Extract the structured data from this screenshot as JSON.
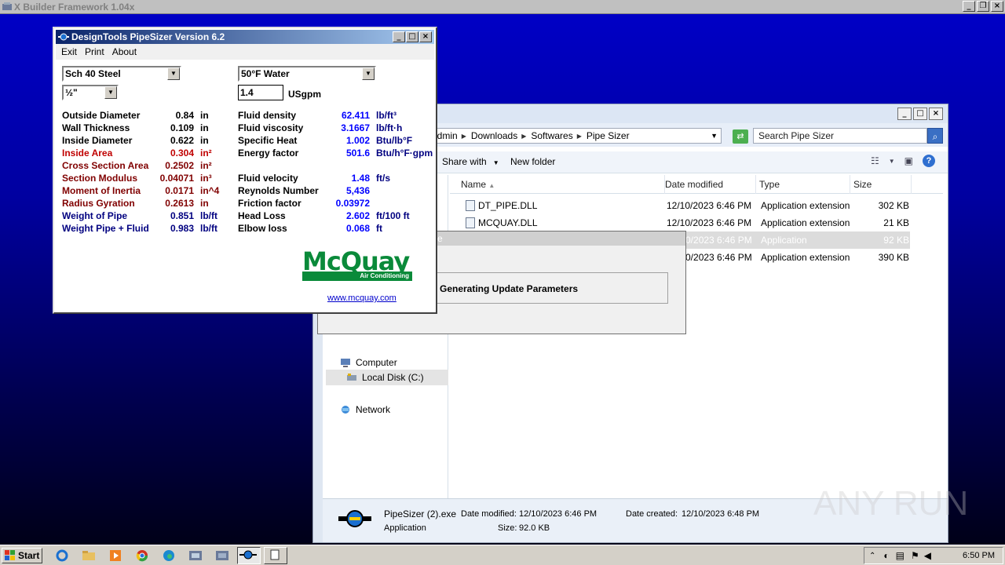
{
  "xbuilder": {
    "title": "X Builder Framework 1.04x"
  },
  "explorer": {
    "breadcrumb": [
      "admin",
      "Downloads",
      "Softwares",
      "Pipe Sizer"
    ],
    "search_placeholder": "Search Pipe Sizer",
    "toolbar": {
      "share_with": "Share with",
      "new_folder": "New folder"
    },
    "nav": {
      "computer": "Computer",
      "local_disk": "Local Disk (C:)",
      "network": "Network"
    },
    "columns": {
      "name": "Name",
      "date_modified": "Date modified",
      "type": "Type",
      "size": "Size"
    },
    "files": [
      {
        "name": "DT_PIPE.DLL",
        "date": "12/10/2023 6:46 PM",
        "type": "Application extension",
        "size": "302 KB"
      },
      {
        "name": "MCQUAY.DLL",
        "date": "12/10/2023 6:46 PM",
        "type": "Application extension",
        "size": "21 KB"
      },
      {
        "name": "",
        "date": "/10/2023 6:46 PM",
        "type": "Application",
        "size": "92 KB"
      },
      {
        "name": "",
        "date": "/10/2023 6:46 PM",
        "type": "Application extension",
        "size": "390 KB"
      }
    ],
    "details": {
      "filename": "PipeSizer (2).exe",
      "date_modified_label": "Date modified:",
      "date_modified": "12/10/2023 6:46 PM",
      "date_created_label": "Date created:",
      "date_created": "12/10/2023 6:48 PM",
      "type": "Application",
      "size_label": "Size:",
      "size": "92.0 KB"
    }
  },
  "progress": {
    "title_fragment": "e",
    "message": "Generating Update Parameters"
  },
  "pipesizer": {
    "title": "DesignTools PipeSizer Version 6.2",
    "menu": [
      "Exit",
      "Print",
      "About"
    ],
    "pipe_type": "Sch 40 Steel",
    "pipe_size": "½\"",
    "fluid": "50°F Water",
    "flow": "1.4",
    "flow_unit": "USgpm",
    "left_props": [
      {
        "label": "Outside Diameter",
        "value": "0.84",
        "unit": "in",
        "color": "black"
      },
      {
        "label": "Wall Thickness",
        "value": "0.109",
        "unit": "in",
        "color": "black"
      },
      {
        "label": "Inside Diameter",
        "value": "0.622",
        "unit": "in",
        "color": "black"
      },
      {
        "label": "Inside Area",
        "value": "0.304",
        "unit": "in²",
        "color": "red"
      },
      {
        "label": "Cross Section Area",
        "value": "0.2502",
        "unit": "in²",
        "color": "dred"
      },
      {
        "label": "Section Modulus",
        "value": "0.04071",
        "unit": "in³",
        "color": "dred"
      },
      {
        "label": "Moment of Inertia",
        "value": "0.0171",
        "unit": "in^4",
        "color": "dred"
      },
      {
        "label": "Radius Gyration",
        "value": "0.2613",
        "unit": "in",
        "color": "dred"
      },
      {
        "label": "Weight of Pipe",
        "value": "0.851",
        "unit": "lb/ft",
        "color": "navy"
      },
      {
        "label": "Weight Pipe + Fluid",
        "value": "0.983",
        "unit": "lb/ft",
        "color": "navy"
      }
    ],
    "right_props_top": [
      {
        "label": "Fluid density",
        "value": "62.411",
        "unit": "lb/ft³"
      },
      {
        "label": "Fluid viscosity",
        "value": "3.1667",
        "unit": "lb/ft·h"
      },
      {
        "label": "Specific Heat",
        "value": "1.002",
        "unit": "Btu/lb°F"
      },
      {
        "label": "Energy factor",
        "value": "501.6",
        "unit": "Btu/h°F·gpm"
      }
    ],
    "right_props_bottom": [
      {
        "label": "Fluid velocity",
        "value": "1.48",
        "unit": "ft/s"
      },
      {
        "label": "Reynolds Number",
        "value": "5,436",
        "unit": ""
      },
      {
        "label": "Friction factor",
        "value": "0.03972",
        "unit": ""
      },
      {
        "label": "Head Loss",
        "value": "2.602",
        "unit": "ft/100 ft"
      },
      {
        "label": "Elbow loss",
        "value": "0.068",
        "unit": "ft"
      }
    ],
    "logo_word": "McQuay",
    "logo_sub": "Air Conditioning",
    "link": "www.mcquay.com"
  },
  "taskbar": {
    "start": "Start",
    "clock": "6:50 PM"
  },
  "watermark": "ANY RUN",
  "colors": {
    "title_gradient_start": "#0a246a",
    "mcquay_green": "#0a8a3a",
    "label_red": "#c00000",
    "label_navy": "#000080"
  }
}
